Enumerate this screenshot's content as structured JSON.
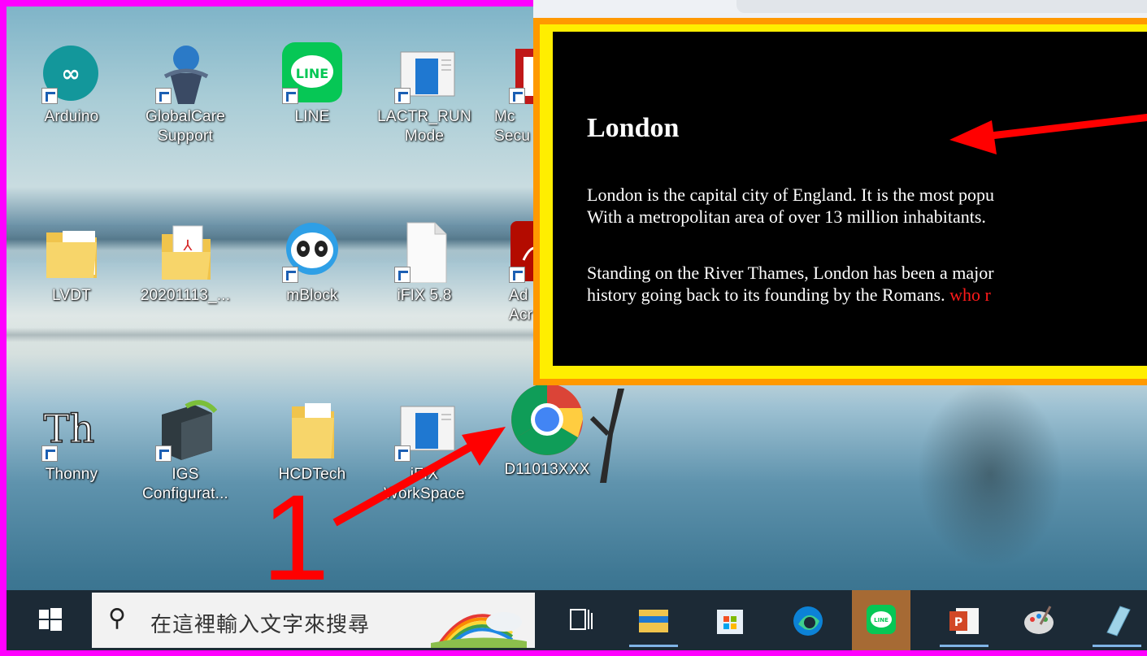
{
  "desktop": {
    "icons": [
      {
        "label": "Arduino",
        "icon": "arduino-icon"
      },
      {
        "label": "GlobalCare\nSupport",
        "icon": "globalcare-icon"
      },
      {
        "label": "LINE",
        "icon": "line-icon"
      },
      {
        "label": "LACTR_RUN\nMode",
        "icon": "lactr-window-icon"
      },
      {
        "label": "Mc\nSecu",
        "icon": "mcafee-icon"
      },
      {
        "label": "LVDT",
        "icon": "folder-icon"
      },
      {
        "label": "20201113_...",
        "icon": "pdf-folder-icon"
      },
      {
        "label": "mBlock",
        "icon": "mblock-panda-icon"
      },
      {
        "label": "iFIX 5.8",
        "icon": "blank-file-icon"
      },
      {
        "label": "Ad\nAcr",
        "icon": "adobe-acrobat-icon"
      },
      {
        "label": "Thonny",
        "icon": "thonny-icon"
      },
      {
        "label": "IGS\nConfigurat...",
        "icon": "igs-server-icon"
      },
      {
        "label": "HCDTech",
        "icon": "folder-icon"
      },
      {
        "label": "iFIX\nWorkSpace",
        "icon": "ifix-window-icon"
      },
      {
        "label": "D11013XXX",
        "icon": "chrome-icon"
      }
    ]
  },
  "popup": {
    "heading": "London",
    "para1_line1": "London is the capital city of England. It is the most popu",
    "para1_line2": "With a metropolitan area of over 13 million inhabitants.",
    "para2_line1": "Standing on the River Thames, London has been a major",
    "para2_line2": "history going back to its founding by the Romans.",
    "para2_red": "who r",
    "colors": {
      "outer": "#ff9900",
      "inner_border": "#ffee00",
      "background": "#000000",
      "highlight": "#ff1a1a"
    }
  },
  "annotation": {
    "number": "1",
    "color": "#ff0000"
  },
  "taskbar": {
    "search_placeholder": "在這裡輸入文字來搜尋",
    "apps": [
      "task-view-icon",
      "file-explorer-icon",
      "microsoft-store-icon",
      "edge-icon",
      "line-icon",
      "powerpoint-icon",
      "paint-icon",
      "notepad-icon"
    ]
  }
}
